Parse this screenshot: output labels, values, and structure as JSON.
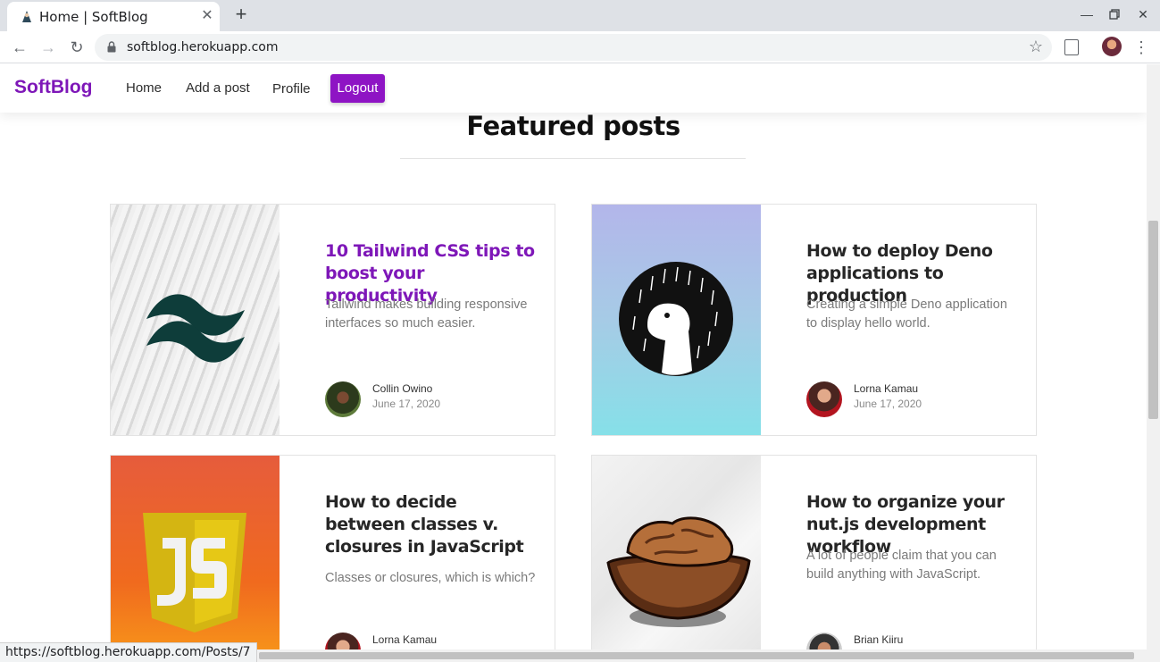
{
  "browser": {
    "tab_title": "Home | SoftBlog",
    "url": "softblog.herokuapp.com",
    "status_url": "https://softblog.herokuapp.com/Posts/7"
  },
  "site": {
    "brand": "SoftBlog",
    "nav": {
      "home": "Home",
      "add_post": "Add a post",
      "profile": "Profile",
      "logout": "Logout"
    },
    "section_title": "Featured posts"
  },
  "posts": [
    {
      "title": "10 Tailwind CSS tips to boost your productivity",
      "excerpt": "Tailwind makes building responsive interfaces so much easier.",
      "author": "Collin Owino",
      "date": "June 17, 2020",
      "thumb_icon": "tailwind-logo-icon"
    },
    {
      "title": "How to deploy Deno applications to production",
      "excerpt": "Creating a simple Deno application to display hello world.",
      "author": "Lorna Kamau",
      "date": "June 17, 2020",
      "thumb_icon": "deno-logo-icon"
    },
    {
      "title": "How to decide between classes v. closures in JavaScript",
      "excerpt": "Classes or closures, which is which?",
      "author": "Lorna Kamau",
      "date": "",
      "thumb_icon": "javascript-logo-icon"
    },
    {
      "title": "How to organize your nut.js development workflow",
      "excerpt": "A lot of people claim that you can build anything with JavaScript.",
      "author": "Brian Kiiru",
      "date": "",
      "thumb_icon": "walnut-icon"
    }
  ],
  "colors": {
    "brand": "#7e17b8",
    "logout_bg": "#8e14c4"
  }
}
